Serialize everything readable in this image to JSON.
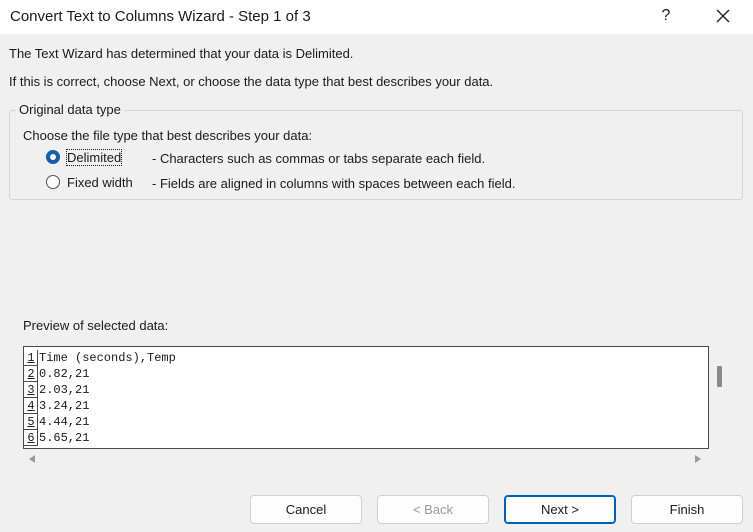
{
  "window": {
    "title": "Convert Text to Columns Wizard - Step 1 of 3",
    "help_label": "?"
  },
  "intro": {
    "line1": "The Text Wizard has determined that your data is Delimited.",
    "line2": "If this is correct, choose Next, or choose the data type that best describes your data."
  },
  "data_type": {
    "group_title": "Original data type",
    "prompt": "Choose the file type that best describes your data:",
    "options": [
      {
        "label": "Delimited",
        "description": "- Characters such as commas or tabs separate each field.",
        "selected": true
      },
      {
        "label": "Fixed width",
        "description": "- Fields are aligned in columns with spaces between each field.",
        "selected": false
      }
    ]
  },
  "preview": {
    "label": "Preview of selected data:",
    "rows": [
      {
        "num": "1",
        "text": "Time (seconds),Temp"
      },
      {
        "num": "2",
        "text": "0.82,21"
      },
      {
        "num": "3",
        "text": "2.03,21"
      },
      {
        "num": "4",
        "text": "3.24,21"
      },
      {
        "num": "5",
        "text": "4.44,21"
      },
      {
        "num": "6",
        "text": "5.65,21"
      }
    ]
  },
  "buttons": {
    "cancel": "Cancel",
    "back": "< Back",
    "next": "Next >",
    "finish": "Finish"
  },
  "colors": {
    "accent": "#005fb8",
    "radio_selected": "#0f5fad",
    "dialog_bg": "#f0f0f0"
  }
}
